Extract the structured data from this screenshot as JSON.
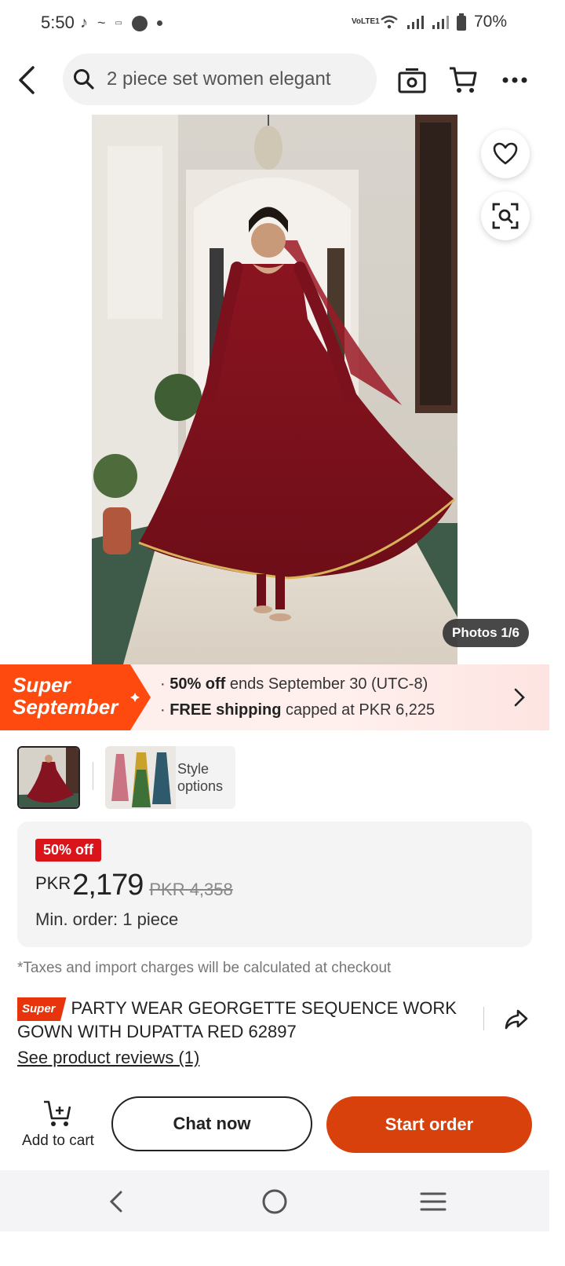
{
  "status_bar": {
    "time": "5:50",
    "battery": "70%",
    "network": "VoLTE1"
  },
  "search": {
    "query": "2 piece set women elegant"
  },
  "gallery": {
    "photo_counter": "Photos 1/6"
  },
  "promo": {
    "badge_line1": "Super",
    "badge_line2": "September",
    "line1_bold": "50% off",
    "line1_rest": "ends September 30 (UTC-8)",
    "line2_bold": "FREE shipping",
    "line2_rest": "capped at PKR 6,225"
  },
  "style_options": {
    "label_line1": "Style",
    "label_line2": "options"
  },
  "price": {
    "discount": "50% off",
    "currency": "PKR",
    "current": "2,179",
    "original": "PKR 4,358",
    "min_order": "Min. order: 1 piece"
  },
  "tax_note": "*Taxes and import charges will be calculated at checkout",
  "product": {
    "tag": "Super",
    "title": "PARTY WEAR GEORGETTE SEQUENCE WORK GOWN WITH DUPATTA RED 62897",
    "reviews": "See product reviews (1)"
  },
  "actions": {
    "add_to_cart": "Add to cart",
    "chat": "Chat now",
    "start_order": "Start order"
  },
  "colors": {
    "accent": "#d8400c",
    "discount_red": "#d9141b",
    "promo_tag": "#ff4a0f"
  }
}
